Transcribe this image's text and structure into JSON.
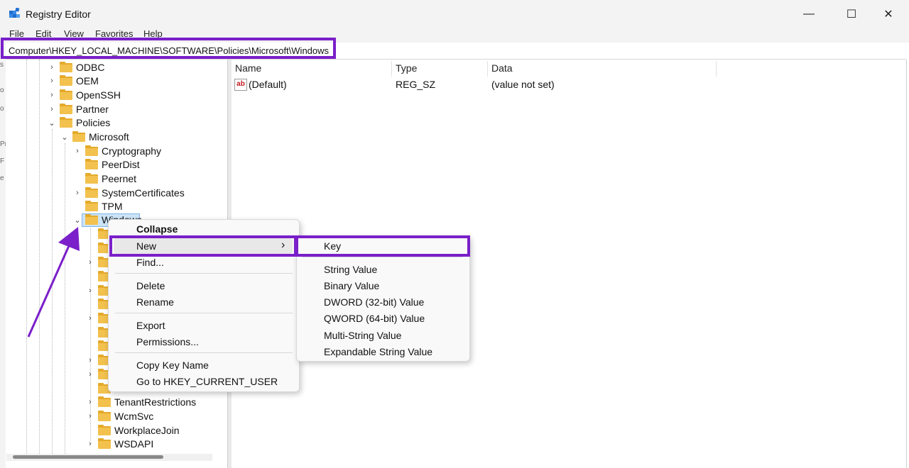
{
  "window": {
    "title": "Registry Editor",
    "minimize_glyph": "—",
    "maximize_glyph": "☐",
    "close_glyph": "✕"
  },
  "menu": [
    "File",
    "Edit",
    "View",
    "Favorites",
    "Help"
  ],
  "address": "Computer\\HKEY_LOCAL_MACHINE\\SOFTWARE\\Policies\\Microsoft\\Windows",
  "tree": {
    "nodes": [
      {
        "label": "ODBC",
        "chevron": "›"
      },
      {
        "label": "OEM",
        "chevron": "›"
      },
      {
        "label": "OpenSSH",
        "chevron": "›"
      },
      {
        "label": "Partner",
        "chevron": "›"
      },
      {
        "label": "Policies",
        "chevron": "⌄"
      },
      {
        "label": "Microsoft",
        "chevron": "⌄"
      },
      {
        "label": "Cryptography",
        "chevron": "›"
      },
      {
        "label": "PeerDist",
        "chevron": ""
      },
      {
        "label": "Peernet",
        "chevron": ""
      },
      {
        "label": "SystemCertificates",
        "chevron": "›"
      },
      {
        "label": "TPM",
        "chevron": ""
      },
      {
        "label": "Windows",
        "chevron": "⌄"
      },
      {
        "label": "TenantRestrictions",
        "chevron": "›"
      },
      {
        "label": "WcmSvc",
        "chevron": "›"
      },
      {
        "label": "WorkplaceJoin",
        "chevron": ""
      },
      {
        "label": "WSDAPI",
        "chevron": "›"
      }
    ]
  },
  "list": {
    "columns": [
      "Name",
      "Type",
      "Data"
    ],
    "rows": [
      {
        "name": "(Default)",
        "type": "REG_SZ",
        "data": "(value not set)",
        "icon": "ab"
      }
    ]
  },
  "context_menu": {
    "items": [
      "Collapse",
      "New",
      "Find...",
      "Delete",
      "Rename",
      "Export",
      "Permissions...",
      "Copy Key Name",
      "Go to HKEY_CURRENT_USER"
    ],
    "submenu_arrow": "›"
  },
  "new_submenu": {
    "items": [
      "Key",
      "String Value",
      "Binary Value",
      "DWORD (32-bit) Value",
      "QWORD (64-bit) Value",
      "Multi-String Value",
      "Expandable String Value"
    ]
  },
  "colors": {
    "highlight": "#7a1fc9",
    "folder": "#f2c14e",
    "selection": "#cce4f7"
  }
}
